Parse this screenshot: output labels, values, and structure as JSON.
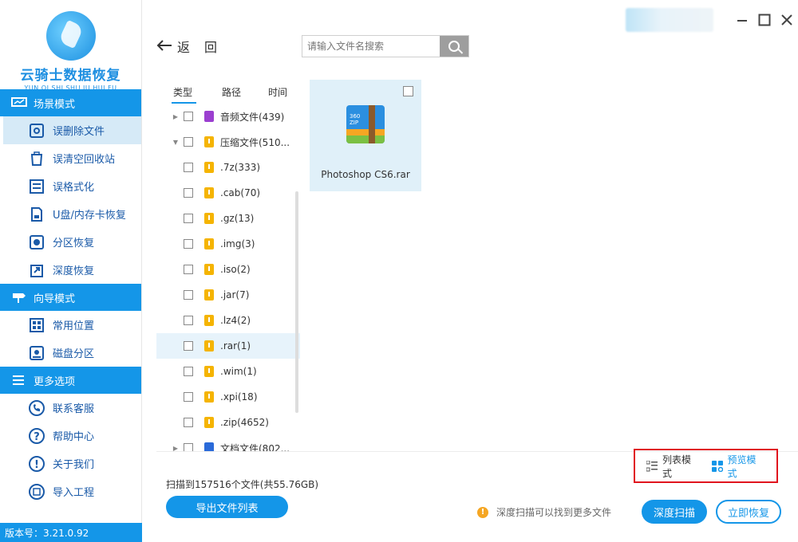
{
  "brand": {
    "title": "云骑士数据恢复",
    "subtitle": "YUN QI SHI SHU JU HUI FU"
  },
  "sidebar": {
    "sections": [
      {
        "label": "场景模式",
        "icon": "monitor-icon"
      },
      {
        "label": "向导模式",
        "icon": "signpost-icon"
      },
      {
        "label": "更多选项",
        "icon": "menu-icon"
      }
    ],
    "scene_items": [
      {
        "label": "误删除文件",
        "icon": "disk-icon",
        "active": true
      },
      {
        "label": "误清空回收站",
        "icon": "recycle-bin-icon"
      },
      {
        "label": "误格式化",
        "icon": "format-icon"
      },
      {
        "label": "U盘/内存卡恢复",
        "icon": "usb-card-icon"
      },
      {
        "label": "分区恢复",
        "icon": "partition-icon"
      },
      {
        "label": "深度恢复",
        "icon": "deep-restore-icon"
      }
    ],
    "guide_items": [
      {
        "label": "常用位置",
        "icon": "windows-icon"
      },
      {
        "label": "磁盘分区",
        "icon": "hard-disk-icon"
      }
    ],
    "more_items": [
      {
        "label": "联系客服",
        "icon": "phone-icon"
      },
      {
        "label": "帮助中心",
        "icon": "help-icon"
      },
      {
        "label": "关于我们",
        "icon": "info-icon"
      },
      {
        "label": "导入工程",
        "icon": "import-icon"
      }
    ],
    "version": "版本号：3.21.0.92"
  },
  "toolbar": {
    "back_label": "返",
    "back_label2": "回",
    "search_placeholder": "请输入文件名搜索"
  },
  "tree": {
    "headers": {
      "type": "类型",
      "path": "路径",
      "time": "时间"
    },
    "rows": [
      {
        "label": "音频文件(439)",
        "expand": "▶",
        "icon": "audio",
        "child": false
      },
      {
        "label": "压缩文件(510...",
        "expand": "▼",
        "icon": "zip",
        "child": false
      },
      {
        "label": ".7z(333)",
        "icon": "zip",
        "child": true
      },
      {
        "label": ".cab(70)",
        "icon": "zip",
        "child": true
      },
      {
        "label": ".gz(13)",
        "icon": "zip",
        "child": true
      },
      {
        "label": ".img(3)",
        "icon": "zip",
        "child": true
      },
      {
        "label": ".iso(2)",
        "icon": "zip",
        "child": true
      },
      {
        "label": ".jar(7)",
        "icon": "zip",
        "child": true
      },
      {
        "label": ".lz4(2)",
        "icon": "zip",
        "child": true
      },
      {
        "label": ".rar(1)",
        "icon": "zip",
        "child": true,
        "selected": true
      },
      {
        "label": ".wim(1)",
        "icon": "zip",
        "child": true
      },
      {
        "label": ".xpi(18)",
        "icon": "zip",
        "child": true
      },
      {
        "label": ".zip(4652)",
        "icon": "zip",
        "child": true
      },
      {
        "label": "文档文件(802...",
        "expand": "▶",
        "icon": "doc",
        "child": false
      }
    ]
  },
  "preview": {
    "files": [
      {
        "name": "Photoshop CS6.rar",
        "icon_text": "360\nZIP"
      }
    ]
  },
  "viewmode": {
    "list_label": "列表模式",
    "preview_label": "预览模式",
    "active": "preview"
  },
  "footer": {
    "scan_info": "扫描到157516个文件(共55.76GB)",
    "export_label": "导出文件列表",
    "hint": "深度扫描可以找到更多文件",
    "deep_scan_label": "深度扫描",
    "recover_label": "立即恢复"
  },
  "colors": {
    "accent": "#1496e8",
    "highlight_box": "#e0141e",
    "active_bg": "#d6eaf7"
  }
}
